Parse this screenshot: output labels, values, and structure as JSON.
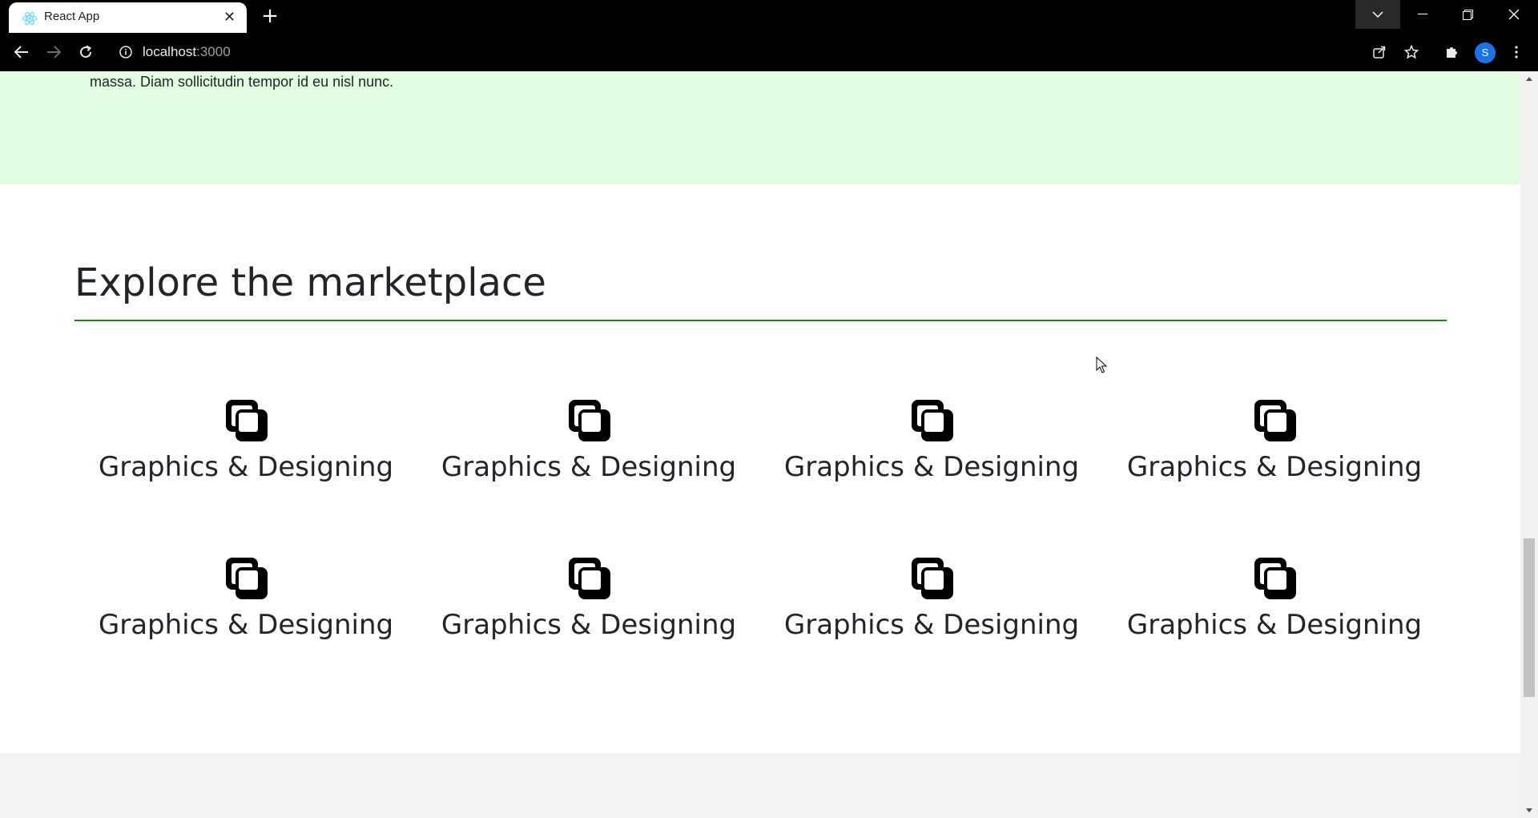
{
  "browser": {
    "tab_title": "React App",
    "url_host": "localhost",
    "url_port": ":3000",
    "profile_initial": "S"
  },
  "page": {
    "intro_text_fragment": "massa. Diam sollicitudin tempor id eu nisl nunc.",
    "section_title": "Explore the marketplace",
    "categories": [
      {
        "label": "Graphics & Designing",
        "icon": "overlapping-squares-icon"
      },
      {
        "label": "Graphics & Designing",
        "icon": "overlapping-squares-icon"
      },
      {
        "label": "Graphics & Designing",
        "icon": "overlapping-squares-icon"
      },
      {
        "label": "Graphics & Designing",
        "icon": "overlapping-squares-icon"
      },
      {
        "label": "Graphics & Designing",
        "icon": "overlapping-squares-icon"
      },
      {
        "label": "Graphics & Designing",
        "icon": "overlapping-squares-icon"
      },
      {
        "label": "Graphics & Designing",
        "icon": "overlapping-squares-icon"
      },
      {
        "label": "Graphics & Designing",
        "icon": "overlapping-squares-icon"
      }
    ]
  },
  "colors": {
    "accent_rule": "#138a13",
    "hero_background": "#e2fce2",
    "browser_chrome": "#000000"
  }
}
